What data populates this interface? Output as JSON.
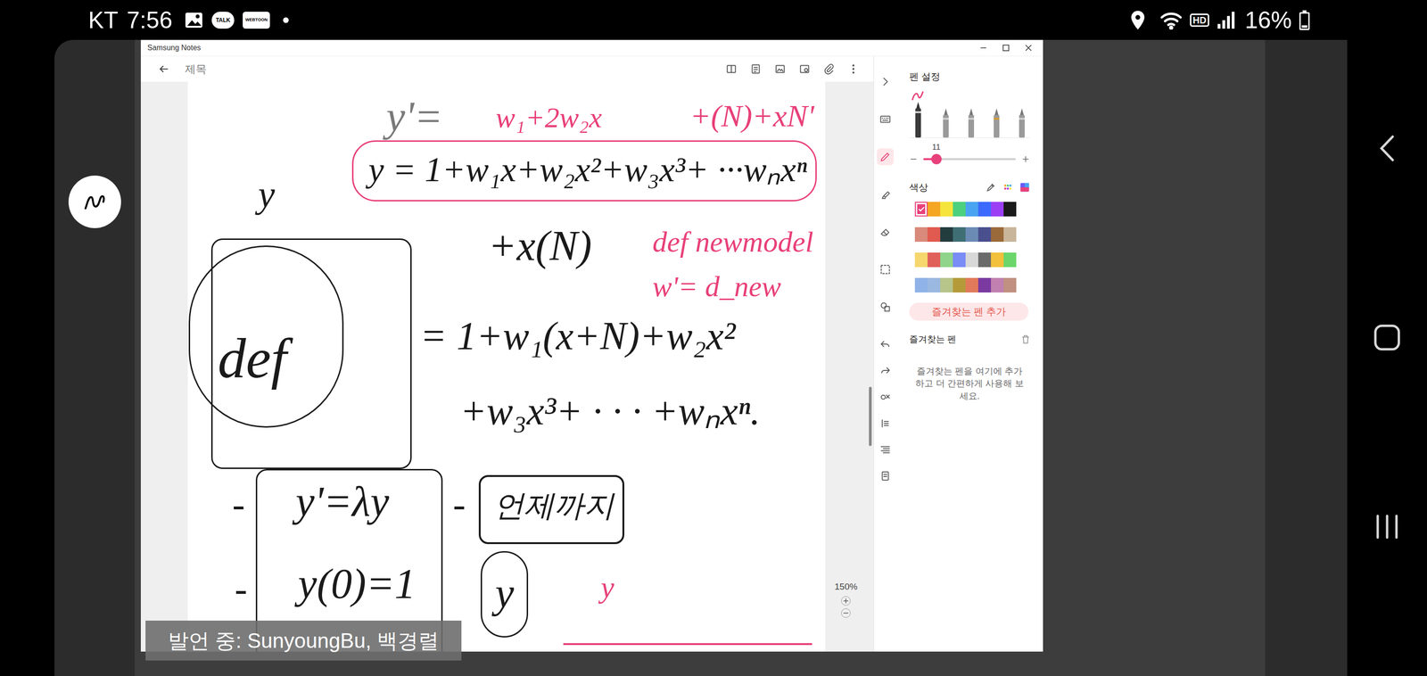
{
  "status_bar": {
    "carrier": "KT",
    "time": "7:56",
    "app_badges": [
      "TALK",
      "WEBTOON"
    ],
    "network": "HD",
    "battery": "16%",
    "battery_level": 0.16
  },
  "window": {
    "title": "Samsung Notes",
    "note_title_placeholder": "제목",
    "zoom": "150%"
  },
  "note": {
    "strokes": [
      {
        "text": "y'=",
        "color": "#7a7a7a"
      },
      {
        "text": "w₁+2w₂x",
        "color": "#e8407a"
      },
      {
        "text": "+(N)+xN'",
        "color": "#e8407a"
      },
      {
        "text": "y = 1+w₁x+w₂x²+w₃x³+ ···wₙxⁿ",
        "color": "#1a1a1a"
      },
      {
        "text": "+x(N)",
        "color": "#1a1a1a"
      },
      {
        "text": "def newmodel",
        "color": "#e8407a"
      },
      {
        "text": "w'= d_new",
        "color": "#e8407a"
      },
      {
        "text": "y",
        "color": "#1a1a1a"
      },
      {
        "text": "def",
        "color": "#1a1a1a"
      },
      {
        "text": "= 1+w₁(x+N)+w₂x²",
        "color": "#1a1a1a"
      },
      {
        "text": "+w₃x³+ · · · +wₙxⁿ.",
        "color": "#1a1a1a"
      },
      {
        "text": "-",
        "color": "#1a1a1a"
      },
      {
        "text": "y'=λy",
        "color": "#1a1a1a"
      },
      {
        "text": "-",
        "color": "#1a1a1a"
      },
      {
        "text": "언제까지",
        "color": "#1a1a1a"
      },
      {
        "text": "-",
        "color": "#1a1a1a"
      },
      {
        "text": "y(0)=1",
        "color": "#1a1a1a"
      },
      {
        "text": "y",
        "color": "#1a1a1a"
      },
      {
        "text": "y",
        "color": "#e8407a"
      }
    ]
  },
  "tools": [
    {
      "kind": "collapse",
      "selected": false
    },
    {
      "kind": "keyboard",
      "selected": false
    },
    {
      "kind": "pen",
      "selected": true
    },
    {
      "kind": "highlighter",
      "selected": false
    },
    {
      "kind": "eraser",
      "selected": false
    },
    {
      "kind": "lasso",
      "selected": false
    },
    {
      "kind": "shape",
      "selected": false
    },
    {
      "kind": "undo",
      "selected": false
    },
    {
      "kind": "redo",
      "selected": false
    },
    {
      "kind": "fill",
      "selected": false
    },
    {
      "kind": "text",
      "selected": false
    },
    {
      "kind": "align",
      "selected": false
    },
    {
      "kind": "page",
      "selected": false
    }
  ],
  "pen_settings": {
    "title": "펜 설정",
    "pens": [
      {
        "selected": true
      },
      {
        "selected": false
      },
      {
        "selected": false
      },
      {
        "selected": false
      },
      {
        "selected": false
      }
    ],
    "size": "11",
    "size_level": 0.14,
    "color_label": "색상",
    "swatches": [
      {
        "color": "#e8407a",
        "selected": true
      },
      {
        "color": "#f5a623",
        "selected": false
      },
      {
        "color": "#f5e43b",
        "selected": false
      },
      {
        "color": "#4cd07d",
        "selected": false
      },
      {
        "color": "#4aa3f0",
        "selected": false
      },
      {
        "color": "#3d6afe",
        "selected": false
      },
      {
        "color": "#9b3ff5",
        "selected": false
      },
      {
        "color": "#1a1a1a",
        "selected": false
      },
      {
        "color": "#d98a7a",
        "selected": false
      },
      {
        "color": "#e05a4f",
        "selected": false
      },
      {
        "color": "#233d3f",
        "selected": false
      },
      {
        "color": "#3f6f74",
        "selected": false
      },
      {
        "color": "#6b8bb5",
        "selected": false
      },
      {
        "color": "#4a4f8e",
        "selected": false
      },
      {
        "color": "#9a6a3a",
        "selected": false
      },
      {
        "color": "#c9b59a",
        "selected": false
      },
      {
        "color": "#f5d76e",
        "selected": false
      },
      {
        "color": "#e0605a",
        "selected": false
      },
      {
        "color": "#8fd48a",
        "selected": false
      },
      {
        "color": "#7a8cf5",
        "selected": false
      },
      {
        "color": "#d8d8d8",
        "selected": false
      },
      {
        "color": "#6a6a6a",
        "selected": false
      },
      {
        "color": "#f2c03a",
        "selected": false
      },
      {
        "color": "#6cd66a",
        "selected": false
      },
      {
        "color": "#8fb3e8",
        "selected": false
      },
      {
        "color": "#9bb8e0",
        "selected": false
      },
      {
        "color": "#b7c48a",
        "selected": false
      },
      {
        "color": "#b59a3a",
        "selected": false
      },
      {
        "color": "#e07a5a",
        "selected": false
      },
      {
        "color": "#7a3aa0",
        "selected": false
      },
      {
        "color": "#c080b0",
        "selected": false
      },
      {
        "color": "#c09080",
        "selected": false
      }
    ],
    "add_favorite": "즐겨찾는 펜 추가",
    "favorites_label": "즐겨찾는 펜",
    "favorites_hint": "즐겨찾는 펜을 여기에 추가하고 더 간편하게 사용해 보세요."
  },
  "speaking": "발언 중: SunyoungBu, 백경렬"
}
